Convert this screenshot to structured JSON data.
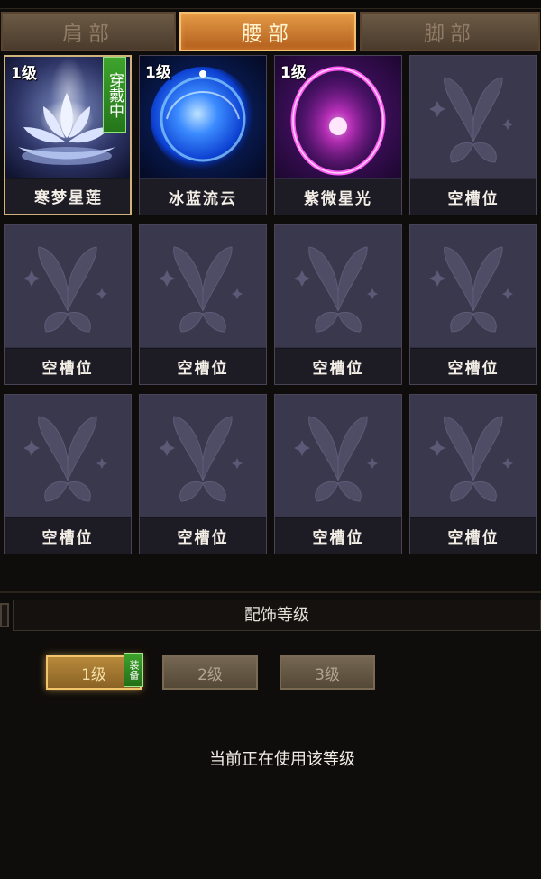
{
  "tabs": [
    {
      "label": "肩部",
      "active": false
    },
    {
      "label": "腰部",
      "active": true
    },
    {
      "label": "脚部",
      "active": false
    }
  ],
  "slots": [
    {
      "name": "寒梦星莲",
      "level": "1级",
      "wearing": "穿戴中",
      "art": "lotus"
    },
    {
      "name": "冰蓝流云",
      "level": "1级",
      "art": "blue-orb"
    },
    {
      "name": "紫微星光",
      "level": "1级",
      "art": "purple-ring"
    },
    {
      "name": "空槽位",
      "art": "empty"
    },
    {
      "name": "空槽位",
      "art": "empty"
    },
    {
      "name": "空槽位",
      "art": "empty"
    },
    {
      "name": "空槽位",
      "art": "empty"
    },
    {
      "name": "空槽位",
      "art": "empty"
    },
    {
      "name": "空槽位",
      "art": "empty"
    },
    {
      "name": "空槽位",
      "art": "empty"
    },
    {
      "name": "空槽位",
      "art": "empty"
    },
    {
      "name": "空槽位",
      "art": "empty"
    }
  ],
  "section": {
    "title": "配饰等级"
  },
  "levels": [
    {
      "label": "1级",
      "active": true,
      "tag": "装备"
    },
    {
      "label": "2级",
      "active": false
    },
    {
      "label": "3级",
      "active": false
    }
  ],
  "status_text": "当前正在使用该等级",
  "colors": {
    "accent": "#e49a45",
    "wearing_green": "#3ea32c",
    "slot_bg": "#3c3a4e"
  }
}
